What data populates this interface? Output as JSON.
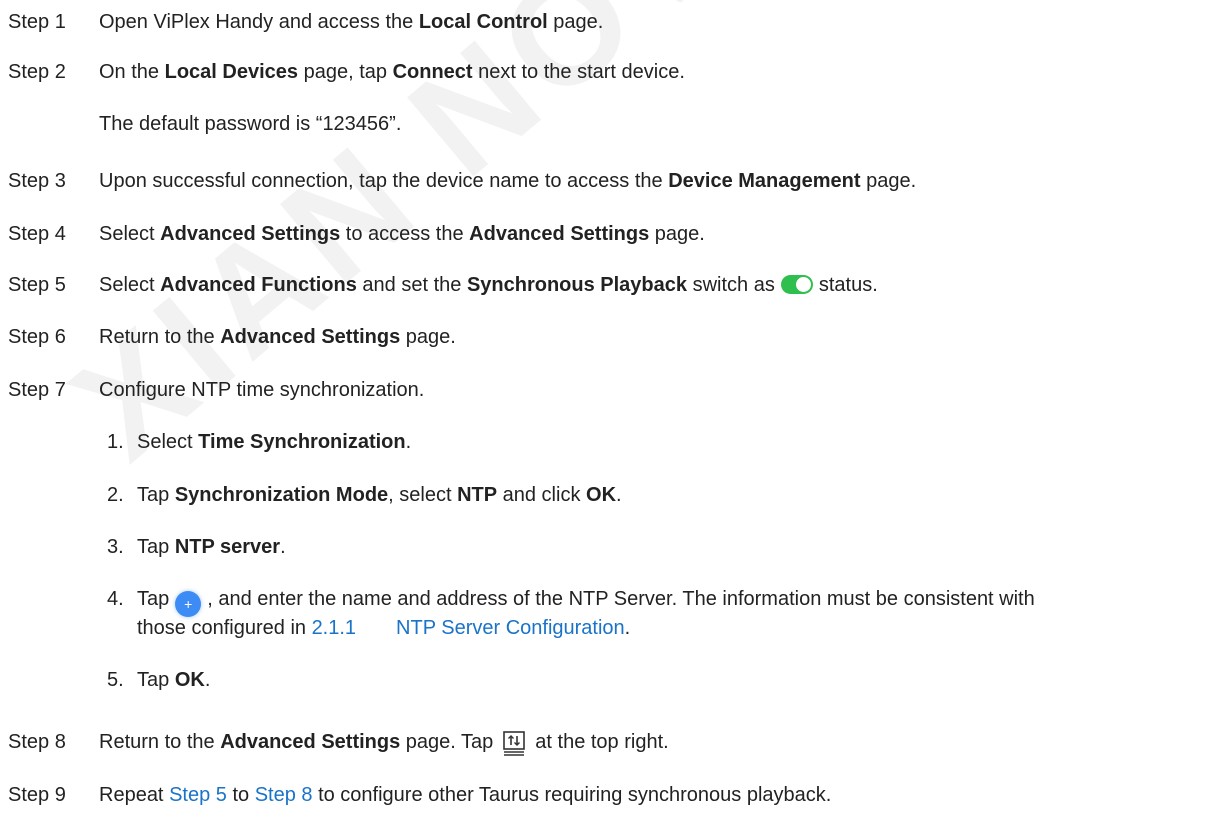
{
  "watermark": "XIAN NOVASTAR TECH",
  "steps": [
    {
      "label": "Step 1",
      "t1": "Open ViPlex Handy and access the ",
      "b1": "Local Control",
      "t2": " page."
    },
    {
      "label": "Step 2",
      "t1": "On the ",
      "b1": "Local Devices",
      "t2": " page, tap ",
      "b2": "Connect",
      "t3": " next to the start device."
    },
    {
      "note": "The default password is “123456”."
    },
    {
      "label": "Step 3",
      "t1": "Upon successful connection, tap the device name to access the ",
      "b1": "Device Management",
      "t2": " page."
    },
    {
      "label": "Step 4",
      "t1": "Select ",
      "b1": "Advanced Settings",
      "t2": " to access the ",
      "b2": "Advanced Settings",
      "t3": " page."
    },
    {
      "label": "Step 5",
      "t1": "Select ",
      "b1": "Advanced Functions",
      "t2": " and set the ",
      "b2": "Synchronous Playback",
      "t3": " switch as",
      "t4": "status.",
      "icon": "toggle-on-icon"
    },
    {
      "label": "Step 6",
      "t1": "Return to the ",
      "b1": "Advanced Settings",
      "t2": " page."
    },
    {
      "label": "Step 7",
      "t1": "Configure NTP time synchronization."
    },
    {
      "label": "Step 8",
      "t1": "Return to the ",
      "b1": "Advanced Settings",
      "t2": " page. Tap",
      "t3": "at the top right.",
      "icon": "sync-monitor-icon"
    },
    {
      "label": "Step 9",
      "t1": "Repeat ",
      "l1": "Step 5",
      "t2": " to ",
      "l2": "Step 8",
      "t3": " to configure other Taurus requiring synchronous playback."
    }
  ],
  "substeps": [
    {
      "n": "1.",
      "t1": "Select ",
      "b1": "Time Synchronization",
      "t2": "."
    },
    {
      "n": "2.",
      "t1": "Tap ",
      "b1": "Synchronization Mode",
      "t2": ", select ",
      "b2": "NTP",
      "t3": " and click ",
      "b3": "OK",
      "t4": "."
    },
    {
      "n": "3.",
      "t1": "Tap ",
      "b1": "NTP server",
      "t2": "."
    },
    {
      "n": "4.",
      "t1": "Tap",
      "t2": ", and enter the name and address of the NTP Server. The information must be consistent with",
      "t3": "those configured in ",
      "l1_num": "2.1.1",
      "l1_title": "NTP Server Configuration",
      "t4": ".",
      "icon": "add-circle-icon"
    },
    {
      "n": "5.",
      "t1": "Tap ",
      "b1": "OK",
      "t2": "."
    }
  ],
  "colors": {
    "link": "#1a73c8",
    "toggle": "#2fbf4f",
    "plus": "#3d8bf5"
  }
}
